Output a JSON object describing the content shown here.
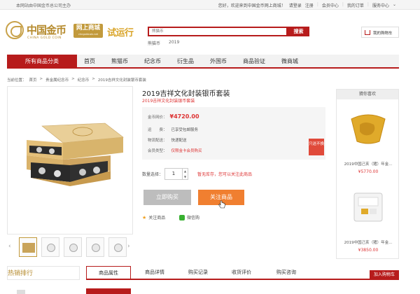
{
  "topbar": {
    "notice": "本网站由中国金币总公司主办",
    "links": [
      "您好，欢迎来到中国金币网上商城！",
      "请登录",
      "注册",
      "会员中心",
      "我的订单",
      "服务中心"
    ]
  },
  "logo": {
    "name_cn": "中国金币",
    "name_en": "CHINA GOLD COIN",
    "mall": "网上商城",
    "mall_sub": "chngoldcoin.net",
    "trial": "试运行"
  },
  "search": {
    "placeholder": "熊猫币",
    "button": "搜索",
    "hot": [
      "熊猫币",
      "2019"
    ]
  },
  "cart": {
    "label": "我的购物车",
    "icon": "cart-icon"
  },
  "nav": {
    "all": "所有商品分类",
    "items": [
      "首页",
      "熊猫币",
      "纪念币",
      "衍生品",
      "外国币",
      "商品验证",
      "微商城"
    ]
  },
  "breadcrumb": [
    "当前位置：",
    "首页",
    ">",
    "贵金属纪念币",
    ">",
    "纪念币",
    ">",
    "2019吉祥文化封装银币套装"
  ],
  "product": {
    "title": "2019吉祥文化封装银币套装",
    "subtitle": "2019吉祥文化封装银币套装",
    "price_label": "金币网价：",
    "price": "¥4720.00",
    "shipping_label": "运　　费：",
    "shipping": "已享受包邮服务",
    "delivery_label": "物流配送：",
    "delivery": "快递配送",
    "member_label": "会员类型：",
    "member": "仅限金卡会员购买",
    "tag": "只送不换",
    "qty_label": "数量选择：",
    "qty": "1",
    "stock": "暂无库存，您可以关注此商品",
    "buy": "立即购买",
    "follow": "关注商品",
    "fav": "关注商品",
    "wechat": "微信购"
  },
  "side": {
    "header": "猜你喜欢",
    "items": [
      {
        "name": "2019中国己亥（猪）年金...",
        "price": "¥5770.00"
      },
      {
        "name": "2019中国己亥（猪）年金...",
        "price": "¥3850.00"
      }
    ]
  },
  "bottom": {
    "hot": "热销排行",
    "tabs": [
      "商品属性",
      "商品详情",
      "购买记录",
      "收货评价",
      "购买咨询"
    ],
    "add_cart": "加入购物车"
  },
  "colors": {
    "brand_red": "#b71c1c",
    "gold": "#c29a3c",
    "orange": "#f07f30",
    "price_red": "#d33333"
  }
}
